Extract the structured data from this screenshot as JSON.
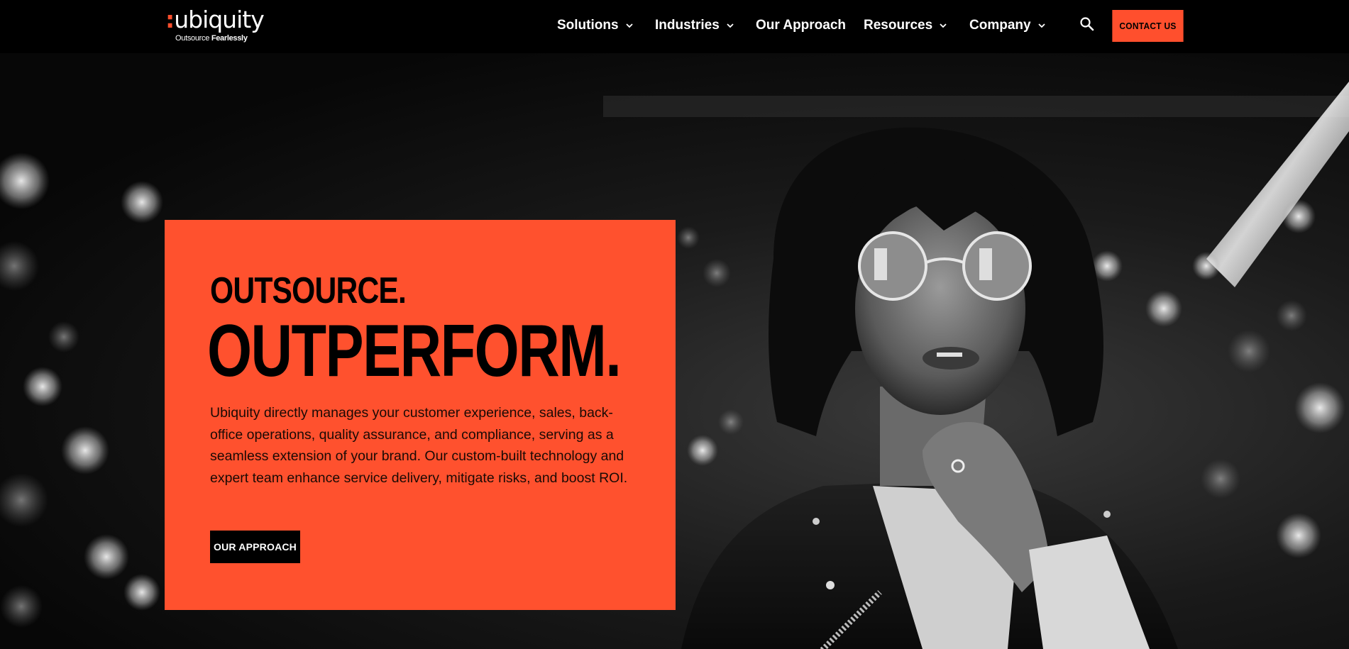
{
  "brand": {
    "logo_text": "ubiquity",
    "logo_colon": ":",
    "tagline_regular": "Outsource",
    "tagline_bold": "Fearlessly",
    "accent_color": "#ff4f2d"
  },
  "nav": {
    "items": [
      {
        "label": "Solutions",
        "has_dropdown": true
      },
      {
        "label": "Industries",
        "has_dropdown": true
      },
      {
        "label": "Our Approach",
        "has_dropdown": false
      },
      {
        "label": "Resources",
        "has_dropdown": true
      },
      {
        "label": "Company",
        "has_dropdown": true
      }
    ],
    "search_icon": "search-icon",
    "contact_label": "CONTACT US"
  },
  "hero": {
    "headline_small": "OUTSOURCE.",
    "headline_big": "OUTPERFORM.",
    "description": "Ubiquity directly manages your customer experience, sales, back-office operations, quality assurance, and compliance, serving as a seamless extension of your brand. Our custom-built technology and expert team enhance service delivery, mitigate risks, and boost ROI.",
    "cta_label": "OUR APPROACH",
    "background_image": "black-and-white photo of woman in round glasses and leather jacket at night with bokeh lights",
    "panel_color": "#ff512e"
  }
}
